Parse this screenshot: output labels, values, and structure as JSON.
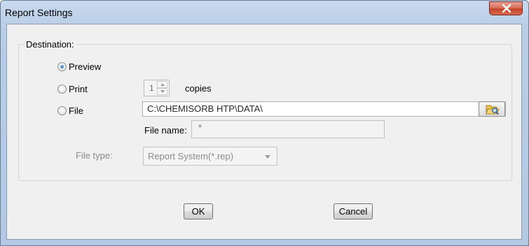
{
  "window": {
    "title": "Report Settings"
  },
  "destination": {
    "group_label": "Destination:",
    "options": {
      "preview": {
        "label": "Preview",
        "selected": true
      },
      "print": {
        "label": "Print",
        "selected": false
      },
      "file": {
        "label": "File",
        "selected": false
      }
    }
  },
  "print": {
    "copies_value": "1",
    "copies_label": "copies"
  },
  "file": {
    "path": "C:\\CHEMISORB HTP\\DATA\\",
    "file_name_label": "File name:",
    "file_name_value": "*",
    "file_type_label": "File type:",
    "file_type_value": "Report System(*.rep)"
  },
  "buttons": {
    "ok": "OK",
    "cancel": "Cancel"
  },
  "icons": {
    "close": "close-icon",
    "browse": "open-folder-icon",
    "spin_up": "spin-up-icon",
    "spin_down": "spin-down-icon",
    "dropdown": "chevron-down-icon"
  }
}
